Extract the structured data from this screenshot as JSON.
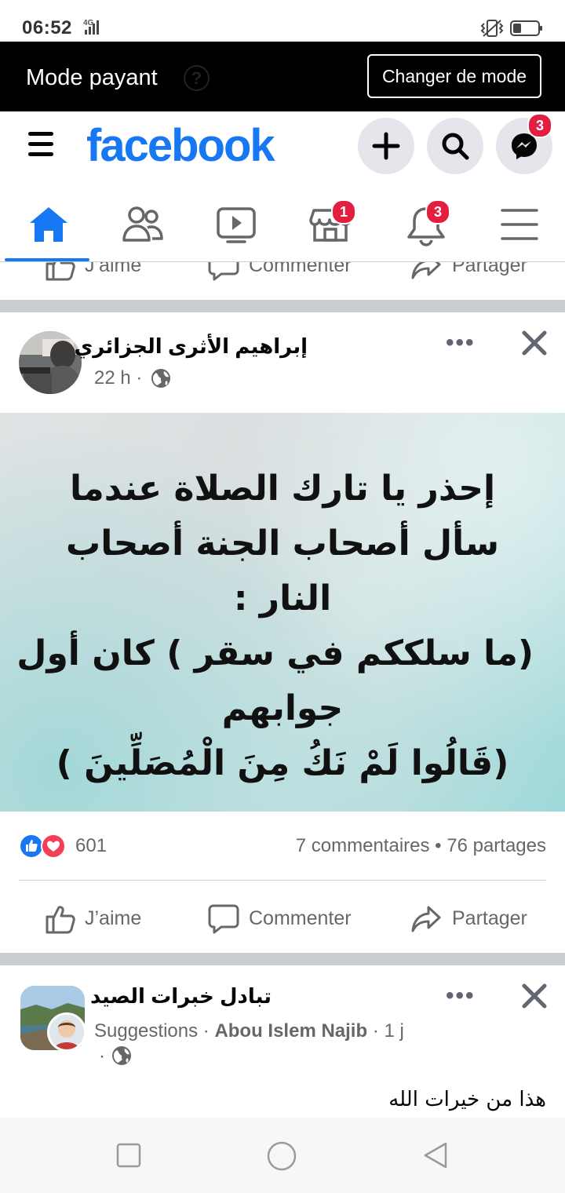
{
  "status_bar": {
    "time": "06:52",
    "network": "4G"
  },
  "mode_bar": {
    "title": "Mode payant",
    "help": "?",
    "switch_button": "Changer de mode"
  },
  "header": {
    "logo": "facebook",
    "messenger_badge": "3",
    "colors": {
      "brand": "#1877f2",
      "badge": "#e41e3f"
    }
  },
  "tabs": {
    "marketplace_badge": "1",
    "notifications_badge": "3"
  },
  "actions": {
    "like": "J’aime",
    "comment": "Commenter",
    "share": "Partager"
  },
  "post1": {
    "author": "إبراهيم الأثرى الجزائري",
    "time": "22 h",
    "separator": "·",
    "dots": "•••",
    "image_text_lines": [
      "إحذر يا تارك الصلاة عندما",
      "سأل أصحاب الجنة أصحاب",
      "النار :",
      "(ما سلككم في سقر ) كان أول",
      "جوابهم",
      "(قَالُوا لَمْ نَكُ مِنَ الْمُصَلِّينَ )"
    ],
    "reaction_count": "601",
    "stats": "7 commentaires • 76 partages"
  },
  "post2": {
    "group": "تبادل خبرات الصيد",
    "suggestions": "Suggestions",
    "dot": "·",
    "author": "Abou Islem Najib",
    "time": "1 j",
    "dot2": "·",
    "dots": "•••",
    "body": "هذا من خيرات الله"
  }
}
